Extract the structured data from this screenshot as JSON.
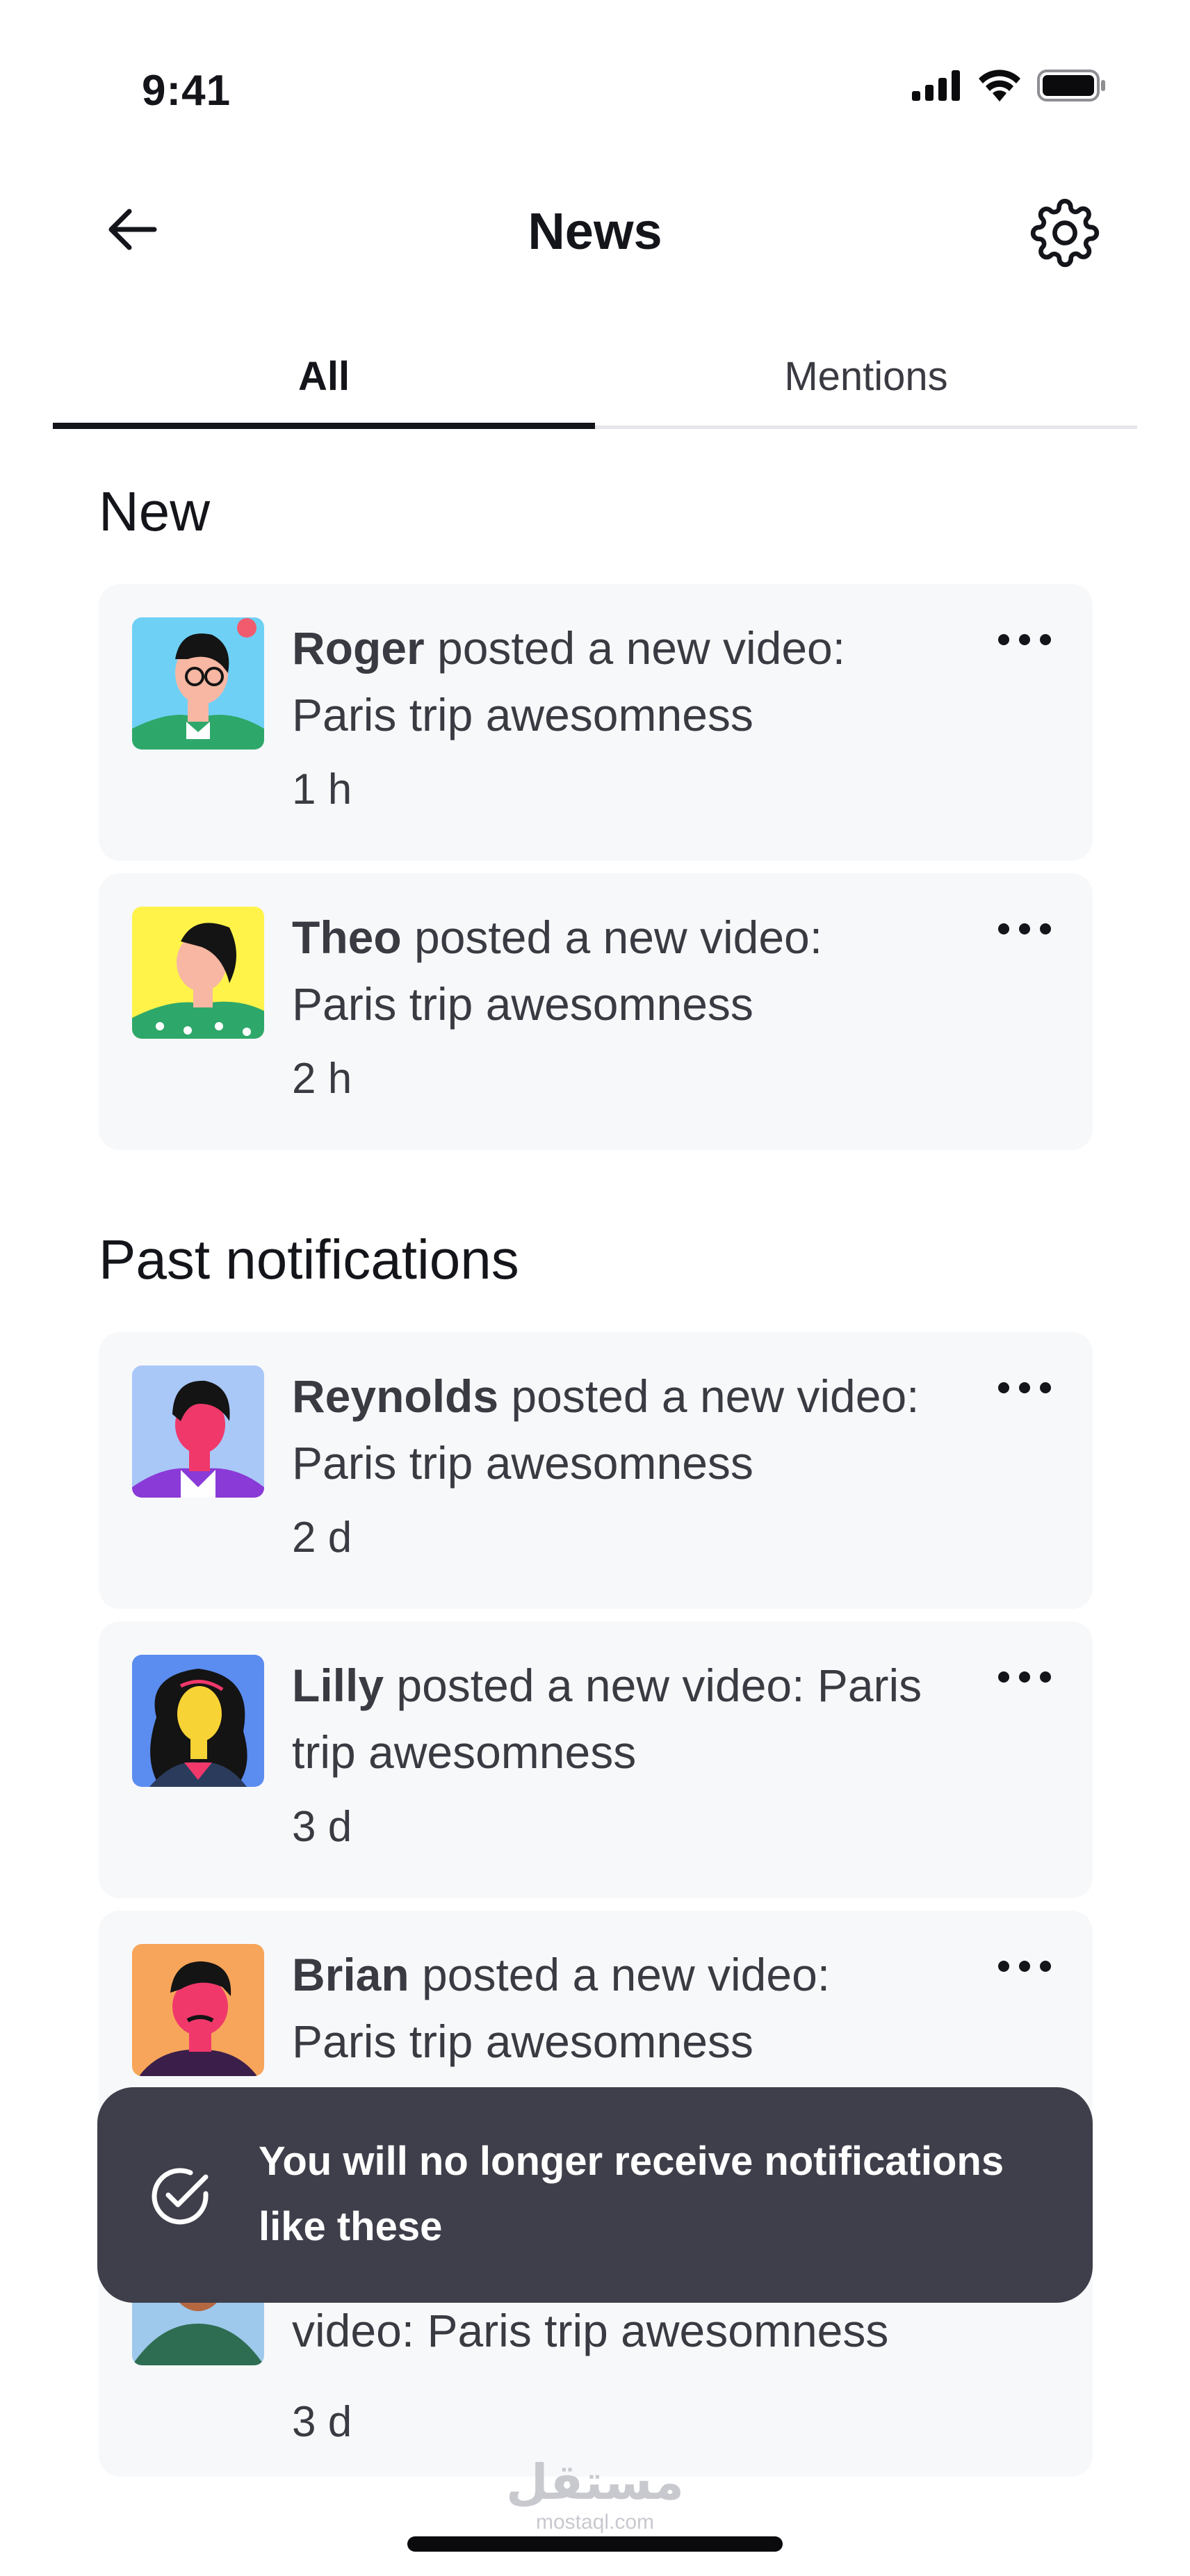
{
  "status_bar": {
    "time": "9:41"
  },
  "header": {
    "title": "News",
    "back_icon": "arrow-left-icon",
    "settings_icon": "gear-icon"
  },
  "tabs": [
    {
      "label": "All",
      "active": true
    },
    {
      "label": "Mentions",
      "active": false
    }
  ],
  "sections": {
    "new_heading": "New",
    "past_heading": "Past notifications"
  },
  "notifications": [
    {
      "name": "Roger",
      "message": " posted a new video: Paris trip awesomness",
      "time": "1 h",
      "section": "new",
      "avatar_bg": "#6fd0f5"
    },
    {
      "name": "Theo",
      "message": " posted a new video: Paris trip awesomness",
      "time": "2 h",
      "section": "new",
      "avatar_bg": "#fff34a"
    },
    {
      "name": "Reynolds",
      "message": " posted a new video: Paris trip awesomness",
      "time": "2 d",
      "section": "past",
      "avatar_bg": "#a9c7f7"
    },
    {
      "name": "Lilly",
      "message": " posted a new video: Paris trip awesomness",
      "time": "3 d",
      "section": "past",
      "avatar_bg": "#5b8cf0"
    },
    {
      "name": "Brian",
      "message": " posted a new video: Paris trip awesomness",
      "time": "",
      "section": "past",
      "avatar_bg": "#f7a55a"
    },
    {
      "name": "",
      "message": "video: Paris trip awesomness",
      "time": "3 d",
      "section": "past",
      "avatar_bg": "#9ec9ec"
    }
  ],
  "toast": {
    "message": "You will no longer receive notifications like these",
    "icon": "check-circle-icon"
  },
  "watermark": {
    "brand": "مستقل",
    "site": "mostaql.com"
  },
  "colors": {
    "card_bg": "#f7f8fa",
    "toast_bg": "#3e3f4a",
    "text_primary": "#14151a",
    "text_secondary": "#3a3b42"
  }
}
